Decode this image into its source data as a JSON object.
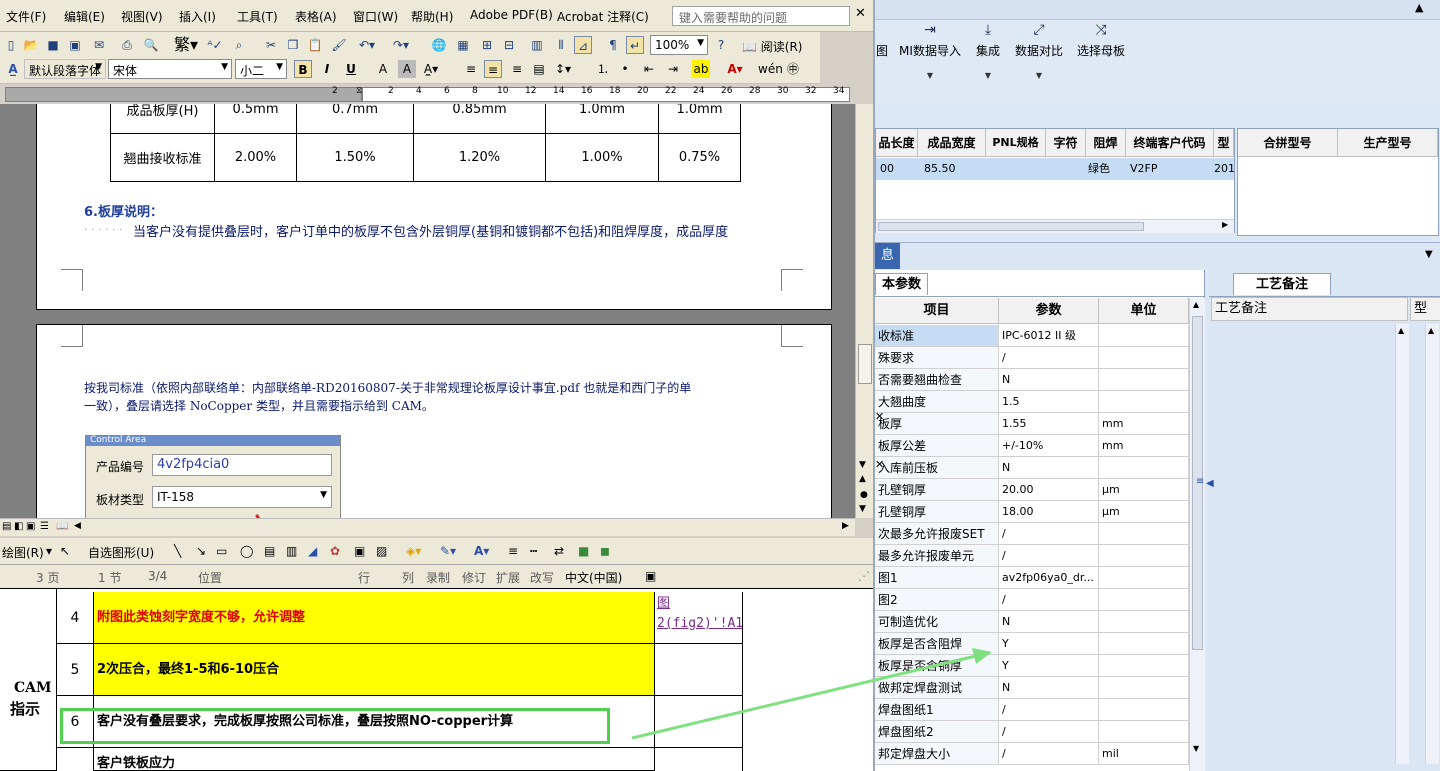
{
  "word": {
    "menu": [
      "文件(F)",
      "编辑(E)",
      "视图(V)",
      "插入(I)",
      "工具(T)",
      "表格(A)",
      "窗口(W)",
      "帮助(H)",
      "Adobe PDF(B)",
      "Acrobat 注释(C)"
    ],
    "help_placeholder": "键入需要帮助的问题",
    "zoom": "100%",
    "read_label": "阅读(R)",
    "style_box": "默认段落字体",
    "font_box": "宋体",
    "size_box": "小二",
    "ruler_ticks": [
      "2",
      "2",
      "4",
      "6",
      "8",
      "10",
      "12",
      "14",
      "16",
      "18",
      "20",
      "22",
      "24",
      "26",
      "28",
      "30",
      "32",
      "34"
    ],
    "table": {
      "row1": {
        "label": "成品板厚(H)",
        "cells": [
          "0.5mm",
          "0.7mm",
          "0.85mm",
          "1.0mm",
          "1.0mm"
        ]
      },
      "row2": {
        "label": "翘曲接收标准",
        "cells": [
          "2.00%",
          "1.50%",
          "1.20%",
          "1.00%",
          "0.75%"
        ]
      }
    },
    "heading": "6.板厚说明：",
    "para1": "当客户没有提供叠层时，客户订单中的板厚不包含外层铜厚(基铜和镀铜都不包括)和阻焊厚度，成品厚度",
    "para2_line1": "按我司标准（依照内部联络单：内部联络单-RD20160807-关于非常规理论板厚设计事宜.pdf 也就是和西门子的单",
    "para2_line2": "一致），叠层请选择 NoCopper 类型，并且需要指示给到 CAM。",
    "control_area": {
      "title": "Control Area",
      "product_label": "产品编号",
      "product_value": "4v2fp4cia0",
      "material_label": "板材类型",
      "material_value": "IT-158"
    },
    "draw_label": "绘图(R)",
    "autoshape_label": "自选图形(U)",
    "status": {
      "page": "3 页",
      "section": "1 节",
      "pages": "3/4",
      "position": "位置",
      "line": "行",
      "col": "列",
      "rec": "录制",
      "trk": "修订",
      "ext": "扩展",
      "ovr": "改写",
      "lang": "中文(中国)"
    }
  },
  "sheet": {
    "group_label_1": "CAM",
    "group_label_2": "指示",
    "rows": [
      {
        "num": "4",
        "text": "附图此类蚀刻字宽度不够，允许调整",
        "link": "图2(fig2)'!A1"
      },
      {
        "num": "5",
        "text": "2次压合，最终1-5和6-10压合",
        "link": ""
      },
      {
        "num": "6",
        "text": "客户没有叠层要求，完成板厚按照公司标准，叠层按照NO-copper计算",
        "link": ""
      },
      {
        "num": "",
        "text": "客户铁板应力",
        "link": ""
      }
    ]
  },
  "app": {
    "ribbon": [
      "图",
      "MI数据导入",
      "集成",
      "数据对比",
      "选择母板"
    ],
    "grid_headers": [
      "品长度",
      "成品宽度",
      "PNL规格",
      "字符",
      "阻焊",
      "终端客户代码",
      "型"
    ],
    "grid_row": [
      "00",
      "85.50",
      "",
      "",
      "绿色",
      "V2FP",
      "201"
    ],
    "grid2_headers": [
      "合拼型号",
      "生产型号"
    ],
    "section_tab": "息",
    "params_tab": "本参数",
    "notes_tab": "工艺备注",
    "notes_header": "工艺备注",
    "notes_header2": "型",
    "param_headers": [
      "项目",
      "参数",
      "单位"
    ],
    "params": [
      [
        "收标准",
        "IPC-6012 II 级",
        ""
      ],
      [
        "殊要求",
        "/",
        ""
      ],
      [
        "否需要翘曲检查",
        "N",
        ""
      ],
      [
        "大翘曲度",
        "1.5",
        ""
      ],
      [
        "板厚",
        "1.55",
        "mm"
      ],
      [
        "板厚公差",
        "+/-10%",
        "mm"
      ],
      [
        "入库前压板",
        "N",
        ""
      ],
      [
        "孔壁铜厚",
        "20.00",
        "μm"
      ],
      [
        "孔壁铜厚",
        "18.00",
        "μm"
      ],
      [
        "次最多允许报废SET",
        "/",
        ""
      ],
      [
        "最多允许报废单元",
        "/",
        ""
      ],
      [
        "图1",
        "av2fp06ya0_dr...",
        ""
      ],
      [
        "图2",
        "/",
        ""
      ],
      [
        "可制造优化",
        "N",
        ""
      ],
      [
        "板厚是否含阻焊",
        "Y",
        ""
      ],
      [
        "板厚是否含铜厚",
        "Y",
        ""
      ],
      [
        "做邦定焊盘测试",
        "N",
        ""
      ],
      [
        "焊盘图纸1",
        "/",
        ""
      ],
      [
        "焊盘图纸2",
        "/",
        ""
      ],
      [
        "邦定焊盘大小",
        "/",
        "mil"
      ]
    ]
  },
  "colors": {
    "highlight_yellow": "#ffff00",
    "annotation_green": "#4fd04f",
    "selection_blue": "#c5dcf4",
    "heading_blue": "#1f3fa0",
    "red_text": "#e00000"
  }
}
